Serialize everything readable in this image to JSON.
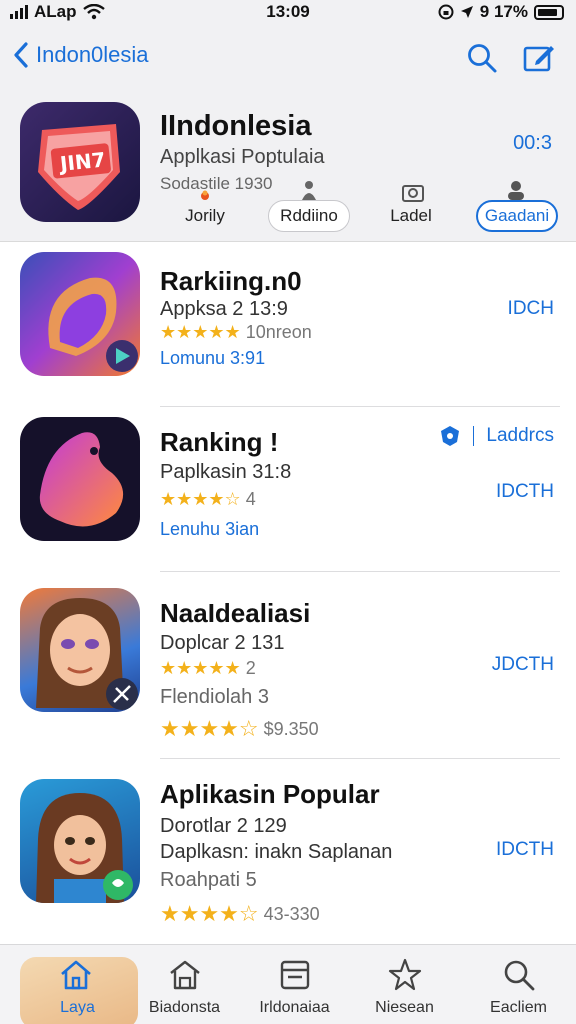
{
  "status_bar": {
    "carrier": "ALap",
    "time": "13:09",
    "battery_text": "9 17%"
  },
  "nav": {
    "back_label": "Indon0lesia"
  },
  "header": {
    "title": "IIndonlesia",
    "subtitle": "Applkasi Poptulaia",
    "meta": "Sodastile 1930",
    "price": "00:3",
    "filters": [
      {
        "label": "Jorily",
        "style": "plain"
      },
      {
        "label": "Rddiino",
        "style": "outline"
      },
      {
        "label": "Ladel",
        "style": "plain"
      },
      {
        "label": "Gaadani",
        "style": "active"
      }
    ]
  },
  "apps": [
    {
      "title": "Rarkiing.n0",
      "line1": "Appksa 2 13:9",
      "rating_text": "10nreon",
      "rating": 5,
      "link": "Lomunu 3:91",
      "get": "IDCH"
    },
    {
      "title": "Ranking !",
      "line1": "Paplkasin 31:8",
      "rating_text": "4",
      "rating": 4.5,
      "link": "Lenuhu 3ian",
      "get": "IDCTH",
      "badge_label": "Laddrcs"
    },
    {
      "title": "NaaIdealiasi",
      "line1": "Doplcar 2 131",
      "rating_text": "2",
      "rating": 5,
      "line2": "Flendiolah 3",
      "rating2_text": "$9.350",
      "rating2": 4.5,
      "get": "JDCTH"
    },
    {
      "title": "Aplikasin Popular",
      "line1": "Dorotlar 2 129",
      "line2": "Daplkasn: inakn Saplanan",
      "line3": "Roahpati 5",
      "rating2_text": "43-330",
      "rating2": 4.5,
      "get": "IDCTH"
    }
  ],
  "tabs": [
    {
      "label": "Laya",
      "icon": "home-icon",
      "active": true
    },
    {
      "label": "Biadonsta",
      "icon": "store-icon",
      "active": false
    },
    {
      "label": "Irldonaiaa",
      "icon": "document-icon",
      "active": false
    },
    {
      "label": "Niesean",
      "icon": "star-icon",
      "active": false
    },
    {
      "label": "Eacliem",
      "icon": "search-icon",
      "active": false
    }
  ],
  "colors": {
    "accent": "#1a6fd8",
    "star": "#f3b11b",
    "bar_bg": "#f1f1f3"
  }
}
